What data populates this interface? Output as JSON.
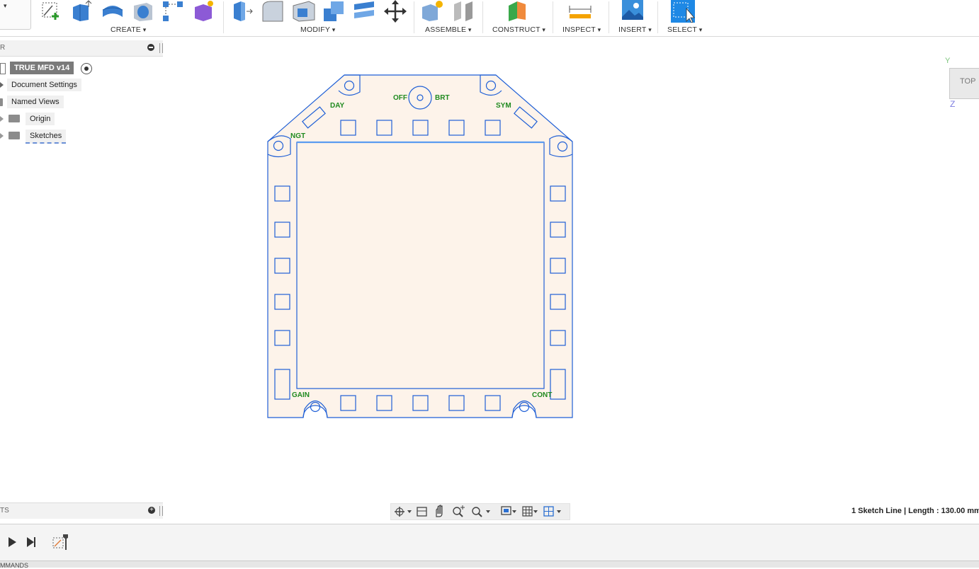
{
  "ribbon": {
    "doc_menu_arrow": "▾",
    "groups": [
      {
        "label": "CREATE"
      },
      {
        "label": "MODIFY"
      },
      {
        "label": "ASSEMBLE"
      },
      {
        "label": "CONSTRUCT"
      },
      {
        "label": "INSPECT"
      },
      {
        "label": "INSERT"
      },
      {
        "label": "SELECT"
      }
    ],
    "tools": {
      "create": [
        "create-sketch-icon",
        "extrude-icon",
        "revolve-icon",
        "hole-icon",
        "pattern-icon",
        "create-form-icon"
      ],
      "modify": [
        "press-pull-icon",
        "fillet-icon",
        "shell-icon",
        "combine-icon",
        "align-icon",
        "move-icon"
      ],
      "assemble": [
        "new-component-icon",
        "joint-icon"
      ],
      "construct": [
        "plane-icon"
      ],
      "inspect": [
        "measure-icon"
      ],
      "insert": [
        "insert-image-icon"
      ],
      "select": [
        "select-icon"
      ]
    },
    "accent_select": "#1e88e5"
  },
  "browser": {
    "header_text": "R",
    "items": [
      {
        "label": "TRUE MFD v14"
      },
      {
        "label": "Document Settings"
      },
      {
        "label": "Named Views"
      },
      {
        "label": "Origin"
      },
      {
        "label": "Sketches"
      }
    ]
  },
  "sketch": {
    "labels": {
      "off": "OFF",
      "brt": "BRT",
      "day": "DAY",
      "sym": "SYM",
      "ngt": "NGT",
      "gain": "GAIN",
      "cont": "CONT"
    },
    "line_color": "#1f5fd6",
    "fill_color": "#fdf3ea",
    "label_color": "#1f8a1f"
  },
  "viewcube": {
    "face": "TOP",
    "axis_y": "Y",
    "axis_z": "Z"
  },
  "comments_panel": {
    "header_text": "TS"
  },
  "status": {
    "text": "1 Sketch Line | Length : 130.00 mm"
  },
  "commands_bar": {
    "text": "MMANDS"
  }
}
